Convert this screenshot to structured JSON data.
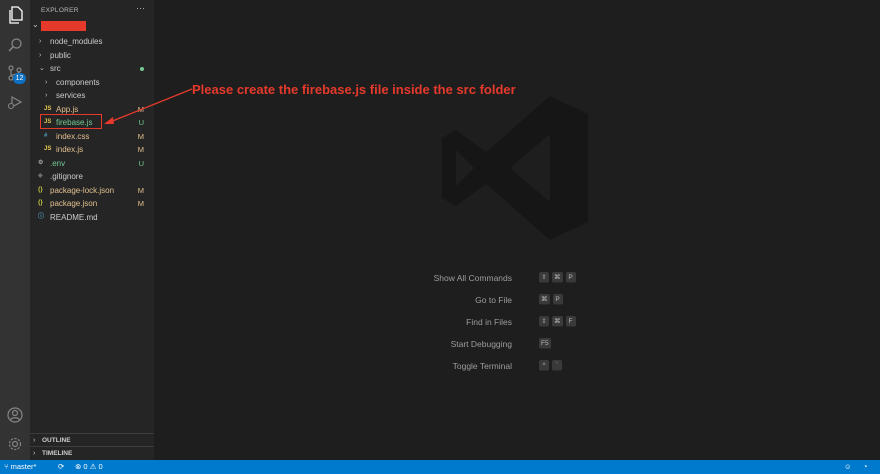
{
  "explorer": {
    "title": "EXPLORER",
    "more": "···"
  },
  "activity": {
    "scm_badge": "12"
  },
  "tree": [
    {
      "label": "node_modules",
      "type": "folder",
      "expanded": false,
      "status": "",
      "indent": 1
    },
    {
      "label": "public",
      "type": "folder",
      "expanded": false,
      "status": "",
      "indent": 1
    },
    {
      "label": "src",
      "type": "folder",
      "expanded": true,
      "status": "dot",
      "indent": 1
    },
    {
      "label": "components",
      "type": "folder",
      "expanded": false,
      "status": "",
      "indent": 2
    },
    {
      "label": "services",
      "type": "folder",
      "expanded": false,
      "status": "",
      "indent": 2
    },
    {
      "label": "App.js",
      "type": "js",
      "status": "M",
      "indent": 2
    },
    {
      "label": "firebase.js",
      "type": "js",
      "status": "U",
      "indent": 2
    },
    {
      "label": "index.css",
      "type": "css",
      "status": "M",
      "indent": 2
    },
    {
      "label": "index.js",
      "type": "js",
      "status": "M",
      "indent": 2
    },
    {
      "label": ".env",
      "type": "env",
      "status": "U",
      "indent": 1
    },
    {
      "label": ".gitignore",
      "type": "git",
      "status": "",
      "indent": 1
    },
    {
      "label": "package-lock.json",
      "type": "json",
      "status": "M",
      "indent": 1
    },
    {
      "label": "package.json",
      "type": "json",
      "status": "M",
      "indent": 1
    },
    {
      "label": "README.md",
      "type": "md",
      "status": "",
      "indent": 1
    }
  ],
  "panels": {
    "outline": "OUTLINE",
    "timeline": "TIMELINE"
  },
  "annotation": "Please create the firebase.js file inside the src folder",
  "shortcuts": [
    {
      "label": "Show All Commands",
      "keys": [
        "⇧",
        "⌘",
        "P"
      ]
    },
    {
      "label": "Go to File",
      "keys": [
        "⌘",
        "P"
      ]
    },
    {
      "label": "Find in Files",
      "keys": [
        "⇧",
        "⌘",
        "F"
      ]
    },
    {
      "label": "Start Debugging",
      "keys": [
        "F5"
      ]
    },
    {
      "label": "Toggle Terminal",
      "keys": [
        "^",
        "`"
      ]
    }
  ],
  "statusbar": {
    "branch": "master*",
    "errors": "0",
    "warnings": "0"
  },
  "colors": {
    "accent": "#007acc",
    "annotation": "#e53a2b",
    "modified": "#e2c08d",
    "untracked": "#73c991"
  }
}
